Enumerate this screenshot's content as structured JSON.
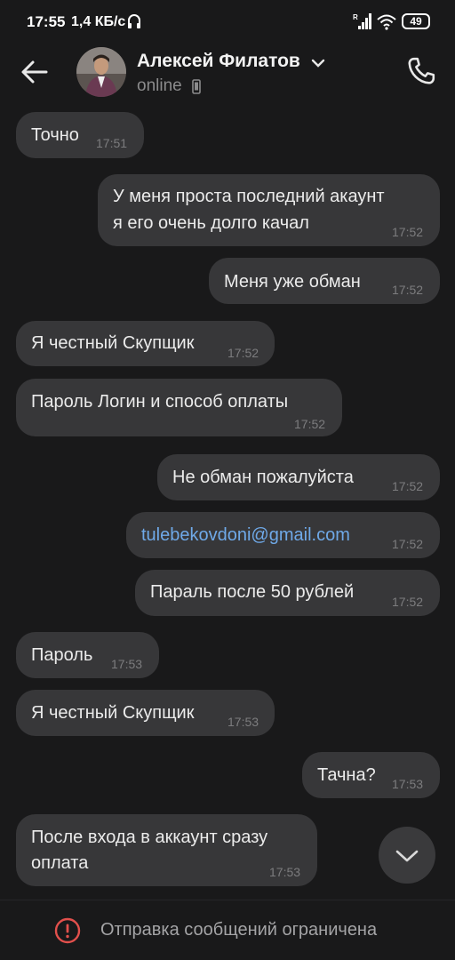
{
  "status_bar": {
    "time": "17:55",
    "speed": "1,4 КБ/с",
    "battery": "49",
    "icons": [
      "headphone-icon",
      "signal-icon",
      "wifi-icon",
      "battery-icon"
    ]
  },
  "header": {
    "name": "Алексей Филатов",
    "status": "online",
    "icons": [
      "back-arrow-icon",
      "chevron-down-icon",
      "phone-small-icon",
      "phone-call-icon"
    ]
  },
  "messages": [
    {
      "side": "in",
      "text": "Точно",
      "time": "17:51"
    },
    {
      "side": "out",
      "lines": [
        "У меня проста последний акаунт",
        "я его очень долго качал"
      ],
      "time": "17:52"
    },
    {
      "side": "out",
      "text": "Меня уже обман",
      "time": "17:52"
    },
    {
      "side": "in",
      "text": "Я честный Скупщик",
      "time": "17:52"
    },
    {
      "side": "in",
      "text": "Пароль Логин и способ оплаты",
      "time": "17:52"
    },
    {
      "side": "out",
      "text": "Не обман пожалуйста",
      "time": "17:52"
    },
    {
      "side": "out",
      "text": "tulebekovdoni@gmail.com",
      "time": "17:52",
      "link": true
    },
    {
      "side": "out",
      "text": "Параль после 50 рублей",
      "time": "17:52"
    },
    {
      "side": "in",
      "text": "Пароль",
      "time": "17:53"
    },
    {
      "side": "in",
      "text": "Я честный Скупщик",
      "time": "17:53"
    },
    {
      "side": "out",
      "text": "Тачна?",
      "time": "17:53"
    },
    {
      "side": "in",
      "lines": [
        "После входа в аккаунт сразу",
        "оплата"
      ],
      "time": "17:53"
    }
  ],
  "bottom_bar": {
    "restricted": "Отправка сообщений ограничена",
    "icon": "alert-circle-icon"
  },
  "colors": {
    "background": "#19191a",
    "bubble": "#373739",
    "link": "#6fa9e8",
    "alert": "#e2504c"
  }
}
